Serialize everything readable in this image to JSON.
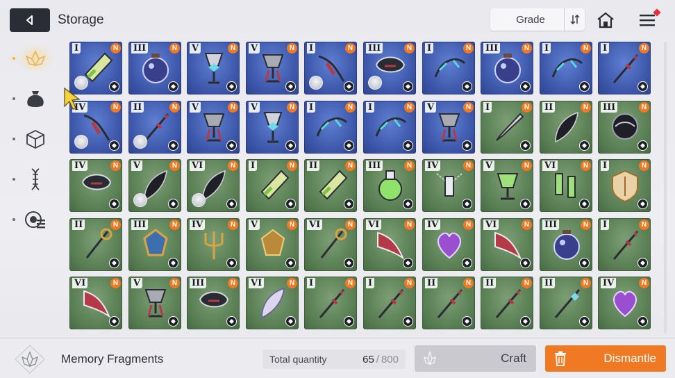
{
  "header": {
    "title": "Storage",
    "sort": {
      "selected": "Grade"
    }
  },
  "side_tabs": [
    {
      "icon": "lotus-icon",
      "active": true
    },
    {
      "icon": "pouch-icon",
      "active": false
    },
    {
      "icon": "cube-icon",
      "active": false
    },
    {
      "icon": "dna-icon",
      "active": false
    },
    {
      "icon": "badge-list-icon",
      "active": false
    }
  ],
  "items": [
    {
      "grade": "I",
      "bg": "blue",
      "new": "N",
      "art": "vial",
      "avatar": true
    },
    {
      "grade": "III",
      "bg": "blue",
      "new": "N",
      "art": "orb",
      "avatar": false
    },
    {
      "grade": "V",
      "bg": "blue",
      "new": "N",
      "art": "chalice-bow",
      "avatar": false
    },
    {
      "grade": "V",
      "bg": "blue",
      "new": "N",
      "art": "chalice",
      "avatar": false
    },
    {
      "grade": "I",
      "bg": "blue",
      "new": "N",
      "art": "bow-red",
      "avatar": true
    },
    {
      "grade": "III",
      "bg": "blue",
      "new": "N",
      "art": "mask",
      "avatar": true
    },
    {
      "grade": "I",
      "bg": "blue",
      "new": "N",
      "art": "bow-teal",
      "avatar": false
    },
    {
      "grade": "III",
      "bg": "blue",
      "new": "N",
      "art": "orb",
      "avatar": false
    },
    {
      "grade": "I",
      "bg": "blue",
      "new": "N",
      "art": "bow-teal",
      "avatar": false
    },
    {
      "grade": "I",
      "bg": "blue",
      "new": "N",
      "art": "staff",
      "avatar": false
    },
    {
      "grade": "IV",
      "bg": "blue",
      "new": "N",
      "art": "bow-red",
      "avatar": true
    },
    {
      "grade": "II",
      "bg": "blue",
      "new": "N",
      "art": "staff",
      "avatar": true
    },
    {
      "grade": "V",
      "bg": "blue",
      "new": "N",
      "art": "chalice",
      "avatar": false
    },
    {
      "grade": "V",
      "bg": "blue",
      "new": "N",
      "art": "chalice-bow",
      "avatar": false
    },
    {
      "grade": "I",
      "bg": "blue",
      "new": "N",
      "art": "bow-teal",
      "avatar": false
    },
    {
      "grade": "I",
      "bg": "blue",
      "new": "N",
      "art": "bow-teal",
      "avatar": false
    },
    {
      "grade": "V",
      "bg": "blue",
      "new": "N",
      "art": "chalice",
      "avatar": false
    },
    {
      "grade": "I",
      "bg": "green",
      "new": "N",
      "art": "dagger",
      "avatar": false
    },
    {
      "grade": "II",
      "bg": "green",
      "new": "N",
      "art": "feather-dark",
      "avatar": false
    },
    {
      "grade": "III",
      "bg": "green",
      "new": "N",
      "art": "mask-dark",
      "avatar": false
    },
    {
      "grade": "IV",
      "bg": "green",
      "new": "N",
      "art": "mask",
      "avatar": false
    },
    {
      "grade": "V",
      "bg": "green",
      "new": "N",
      "art": "feather-dark",
      "avatar": true
    },
    {
      "grade": "VI",
      "bg": "green",
      "new": "N",
      "art": "feather-dark",
      "avatar": true
    },
    {
      "grade": "I",
      "bg": "green",
      "new": "N",
      "art": "vial",
      "avatar": false
    },
    {
      "grade": "II",
      "bg": "green",
      "new": "N",
      "art": "vial",
      "avatar": false
    },
    {
      "grade": "III",
      "bg": "green",
      "new": "N",
      "art": "flask",
      "avatar": false
    },
    {
      "grade": "IV",
      "bg": "green",
      "new": "N",
      "art": "vial-chain",
      "avatar": false
    },
    {
      "grade": "V",
      "bg": "green",
      "new": "N",
      "art": "goblet",
      "avatar": false
    },
    {
      "grade": "VI",
      "bg": "green",
      "new": "N",
      "art": "vials",
      "avatar": false
    },
    {
      "grade": "I",
      "bg": "green",
      "new": "N",
      "art": "shield",
      "avatar": false
    },
    {
      "grade": "II",
      "bg": "green",
      "new": "N",
      "art": "scepter",
      "avatar": false
    },
    {
      "grade": "III",
      "bg": "green",
      "new": "N",
      "art": "crest",
      "avatar": false
    },
    {
      "grade": "IV",
      "bg": "green",
      "new": "N",
      "art": "trident",
      "avatar": false
    },
    {
      "grade": "V",
      "bg": "green",
      "new": "N",
      "art": "crest-gold",
      "avatar": false
    },
    {
      "grade": "VI",
      "bg": "green",
      "new": "N",
      "art": "scepter",
      "avatar": false
    },
    {
      "grade": "VI",
      "bg": "green",
      "new": "N",
      "art": "wing",
      "avatar": false
    },
    {
      "grade": "IV",
      "bg": "green",
      "new": "N",
      "art": "heart",
      "avatar": false
    },
    {
      "grade": "VI",
      "bg": "green",
      "new": "N",
      "art": "wing",
      "avatar": false
    },
    {
      "grade": "III",
      "bg": "green",
      "new": "N",
      "art": "orb",
      "avatar": false
    },
    {
      "grade": "I",
      "bg": "green",
      "new": "N",
      "art": "staff",
      "avatar": false
    },
    {
      "grade": "VI",
      "bg": "green",
      "new": "N",
      "art": "wing",
      "avatar": false
    },
    {
      "grade": "V",
      "bg": "green",
      "new": "N",
      "art": "chalice",
      "avatar": false
    },
    {
      "grade": "III",
      "bg": "green",
      "new": "N",
      "art": "mask",
      "avatar": false
    },
    {
      "grade": "VI",
      "bg": "green",
      "new": "N",
      "art": "feather-light",
      "avatar": false
    },
    {
      "grade": "I",
      "bg": "green",
      "new": "N",
      "art": "staff",
      "avatar": false
    },
    {
      "grade": "I",
      "bg": "green",
      "new": "N",
      "art": "staff",
      "avatar": false
    },
    {
      "grade": "II",
      "bg": "green",
      "new": "N",
      "art": "staff",
      "avatar": false
    },
    {
      "grade": "II",
      "bg": "green",
      "new": "N",
      "art": "staff",
      "avatar": false
    },
    {
      "grade": "II",
      "bg": "green",
      "new": "N",
      "art": "staff-bow",
      "avatar": false
    },
    {
      "grade": "IV",
      "bg": "green",
      "new": "N",
      "art": "heart",
      "avatar": false
    }
  ],
  "footer": {
    "category_label": "Memory Fragments",
    "total_quantity_label": "Total quantity",
    "quantity_current": "65",
    "quantity_separator": "/",
    "quantity_max": "800",
    "craft_label": "Craft",
    "dismantle_label": "Dismantle"
  },
  "colors": {
    "accent": "#f07a24",
    "card_blue": "#3b55a8",
    "card_green": "#587d53",
    "new_badge": "#f07a24"
  }
}
